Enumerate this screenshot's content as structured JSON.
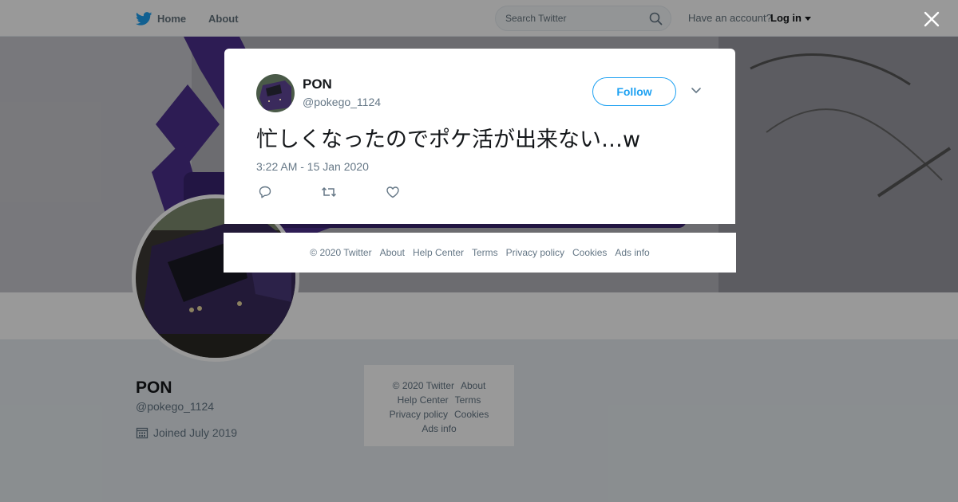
{
  "topbar": {
    "home_label": "Home",
    "about_label": "About",
    "search_placeholder": "Search Twitter",
    "account_prompt": "Have an account?",
    "login_label": "Log in"
  },
  "profile": {
    "name": "PON",
    "handle": "@pokego_1124",
    "joined": "Joined July 2019"
  },
  "side_footer": {
    "links": [
      "© 2020 Twitter",
      "About",
      "Help Center",
      "Terms",
      "Privacy policy",
      "Cookies",
      "Ads info"
    ]
  },
  "tweet": {
    "author_name": "PON",
    "author_handle": "@pokego_1124",
    "follow_label": "Follow",
    "text": "忙しくなったのでポケ活が出来ない…w",
    "timestamp": "3:22 AM - 15 Jan 2020"
  },
  "modal_footer": {
    "links": [
      "© 2020 Twitter",
      "About",
      "Help Center",
      "Terms",
      "Privacy policy",
      "Cookies",
      "Ads info"
    ]
  },
  "colors": {
    "accent": "#1da1f2",
    "banner_purple": "#4b2f8c",
    "text_primary": "#14171a",
    "text_secondary": "#657786"
  },
  "icons": [
    "twitter-bird-icon",
    "search-icon",
    "close-icon",
    "chevron-down-icon",
    "reply-icon",
    "retweet-icon",
    "like-icon",
    "calendar-icon"
  ]
}
